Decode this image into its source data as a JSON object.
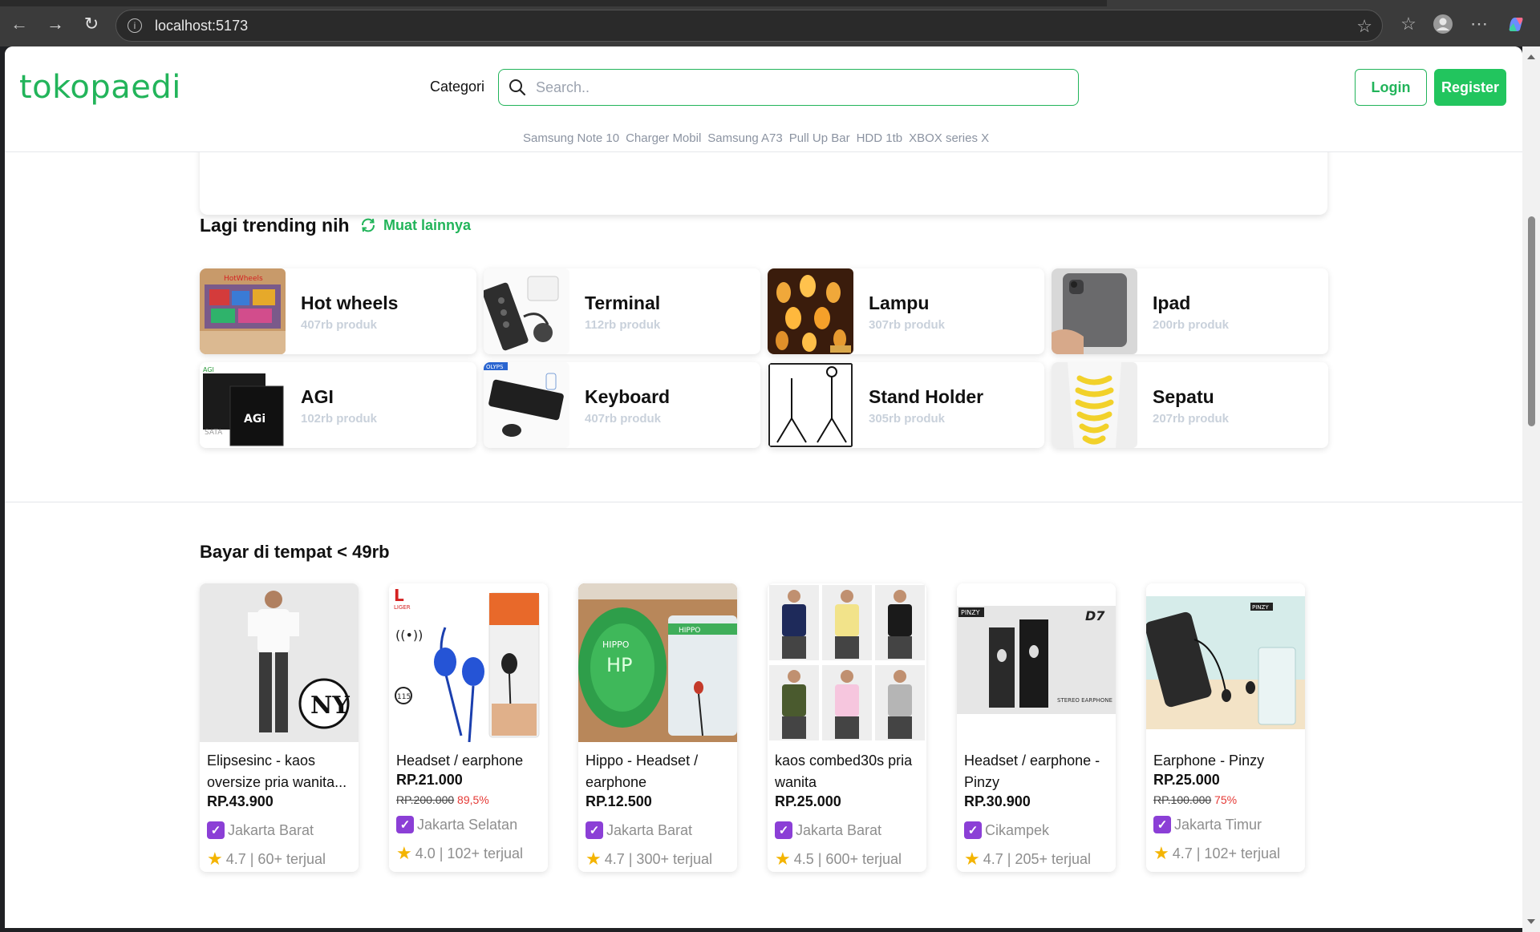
{
  "browser": {
    "url": "localhost:5173"
  },
  "header": {
    "logo": "tokopaedi",
    "categori_label": "Categori",
    "search_placeholder": "Search..",
    "login_label": "Login",
    "register_label": "Register",
    "quick_links": [
      "Samsung Note 10",
      "Charger Mobil",
      "Samsung A73",
      "Pull Up Bar",
      "HDD 1tb",
      "XBOX series X"
    ]
  },
  "trending": {
    "title": "Lagi trending nih",
    "more_label": "Muat lainnya",
    "items": [
      {
        "name": "Hot wheels",
        "count": "407rb produk"
      },
      {
        "name": "Terminal",
        "count": "112rb produk"
      },
      {
        "name": "Lampu",
        "count": "307rb produk"
      },
      {
        "name": "Ipad",
        "count": "200rb produk"
      },
      {
        "name": "AGI",
        "count": "102rb produk"
      },
      {
        "name": "Keyboard",
        "count": "407rb produk"
      },
      {
        "name": "Stand Holder",
        "count": "305rb produk"
      },
      {
        "name": "Sepatu",
        "count": "207rb produk"
      }
    ]
  },
  "cod": {
    "title": "Bayar di tempat < 49rb",
    "products": [
      {
        "name": "Elipsesinc - kaos oversize pria wanita...",
        "price": "RP.43.900",
        "original": "",
        "discount": "",
        "location": "Jakarta Barat",
        "rating": "4.7 | 60+ terjual"
      },
      {
        "name": "Headset / earphone",
        "price": "RP.21.000",
        "original": "RP.200.000",
        "discount": "89,5%",
        "location": "Jakarta Selatan",
        "rating": "4.0 | 102+ terjual"
      },
      {
        "name": "Hippo - Headset / earphone",
        "price": "RP.12.500",
        "original": "",
        "discount": "",
        "location": "Jakarta Barat",
        "rating": "4.7 | 300+ terjual"
      },
      {
        "name": "kaos combed30s pria wanita",
        "price": "RP.25.000",
        "original": "",
        "discount": "",
        "location": "Jakarta Barat",
        "rating": "4.5 | 600+ terjual"
      },
      {
        "name": "Headset / earphone - Pinzy",
        "price": "RP.30.900",
        "original": "",
        "discount": "",
        "location": "Cikampek",
        "rating": "4.7 | 205+ terjual"
      },
      {
        "name": "Earphone - Pinzy",
        "price": "RP.25.000",
        "original": "RP.100.000",
        "discount": "75%",
        "location": "Jakarta Timur",
        "rating": "4.7 | 102+ terjual"
      }
    ]
  },
  "colors": {
    "brand_green": "#22b45a",
    "badge_purple": "#8b3fd6",
    "discount_red": "#e53935"
  }
}
